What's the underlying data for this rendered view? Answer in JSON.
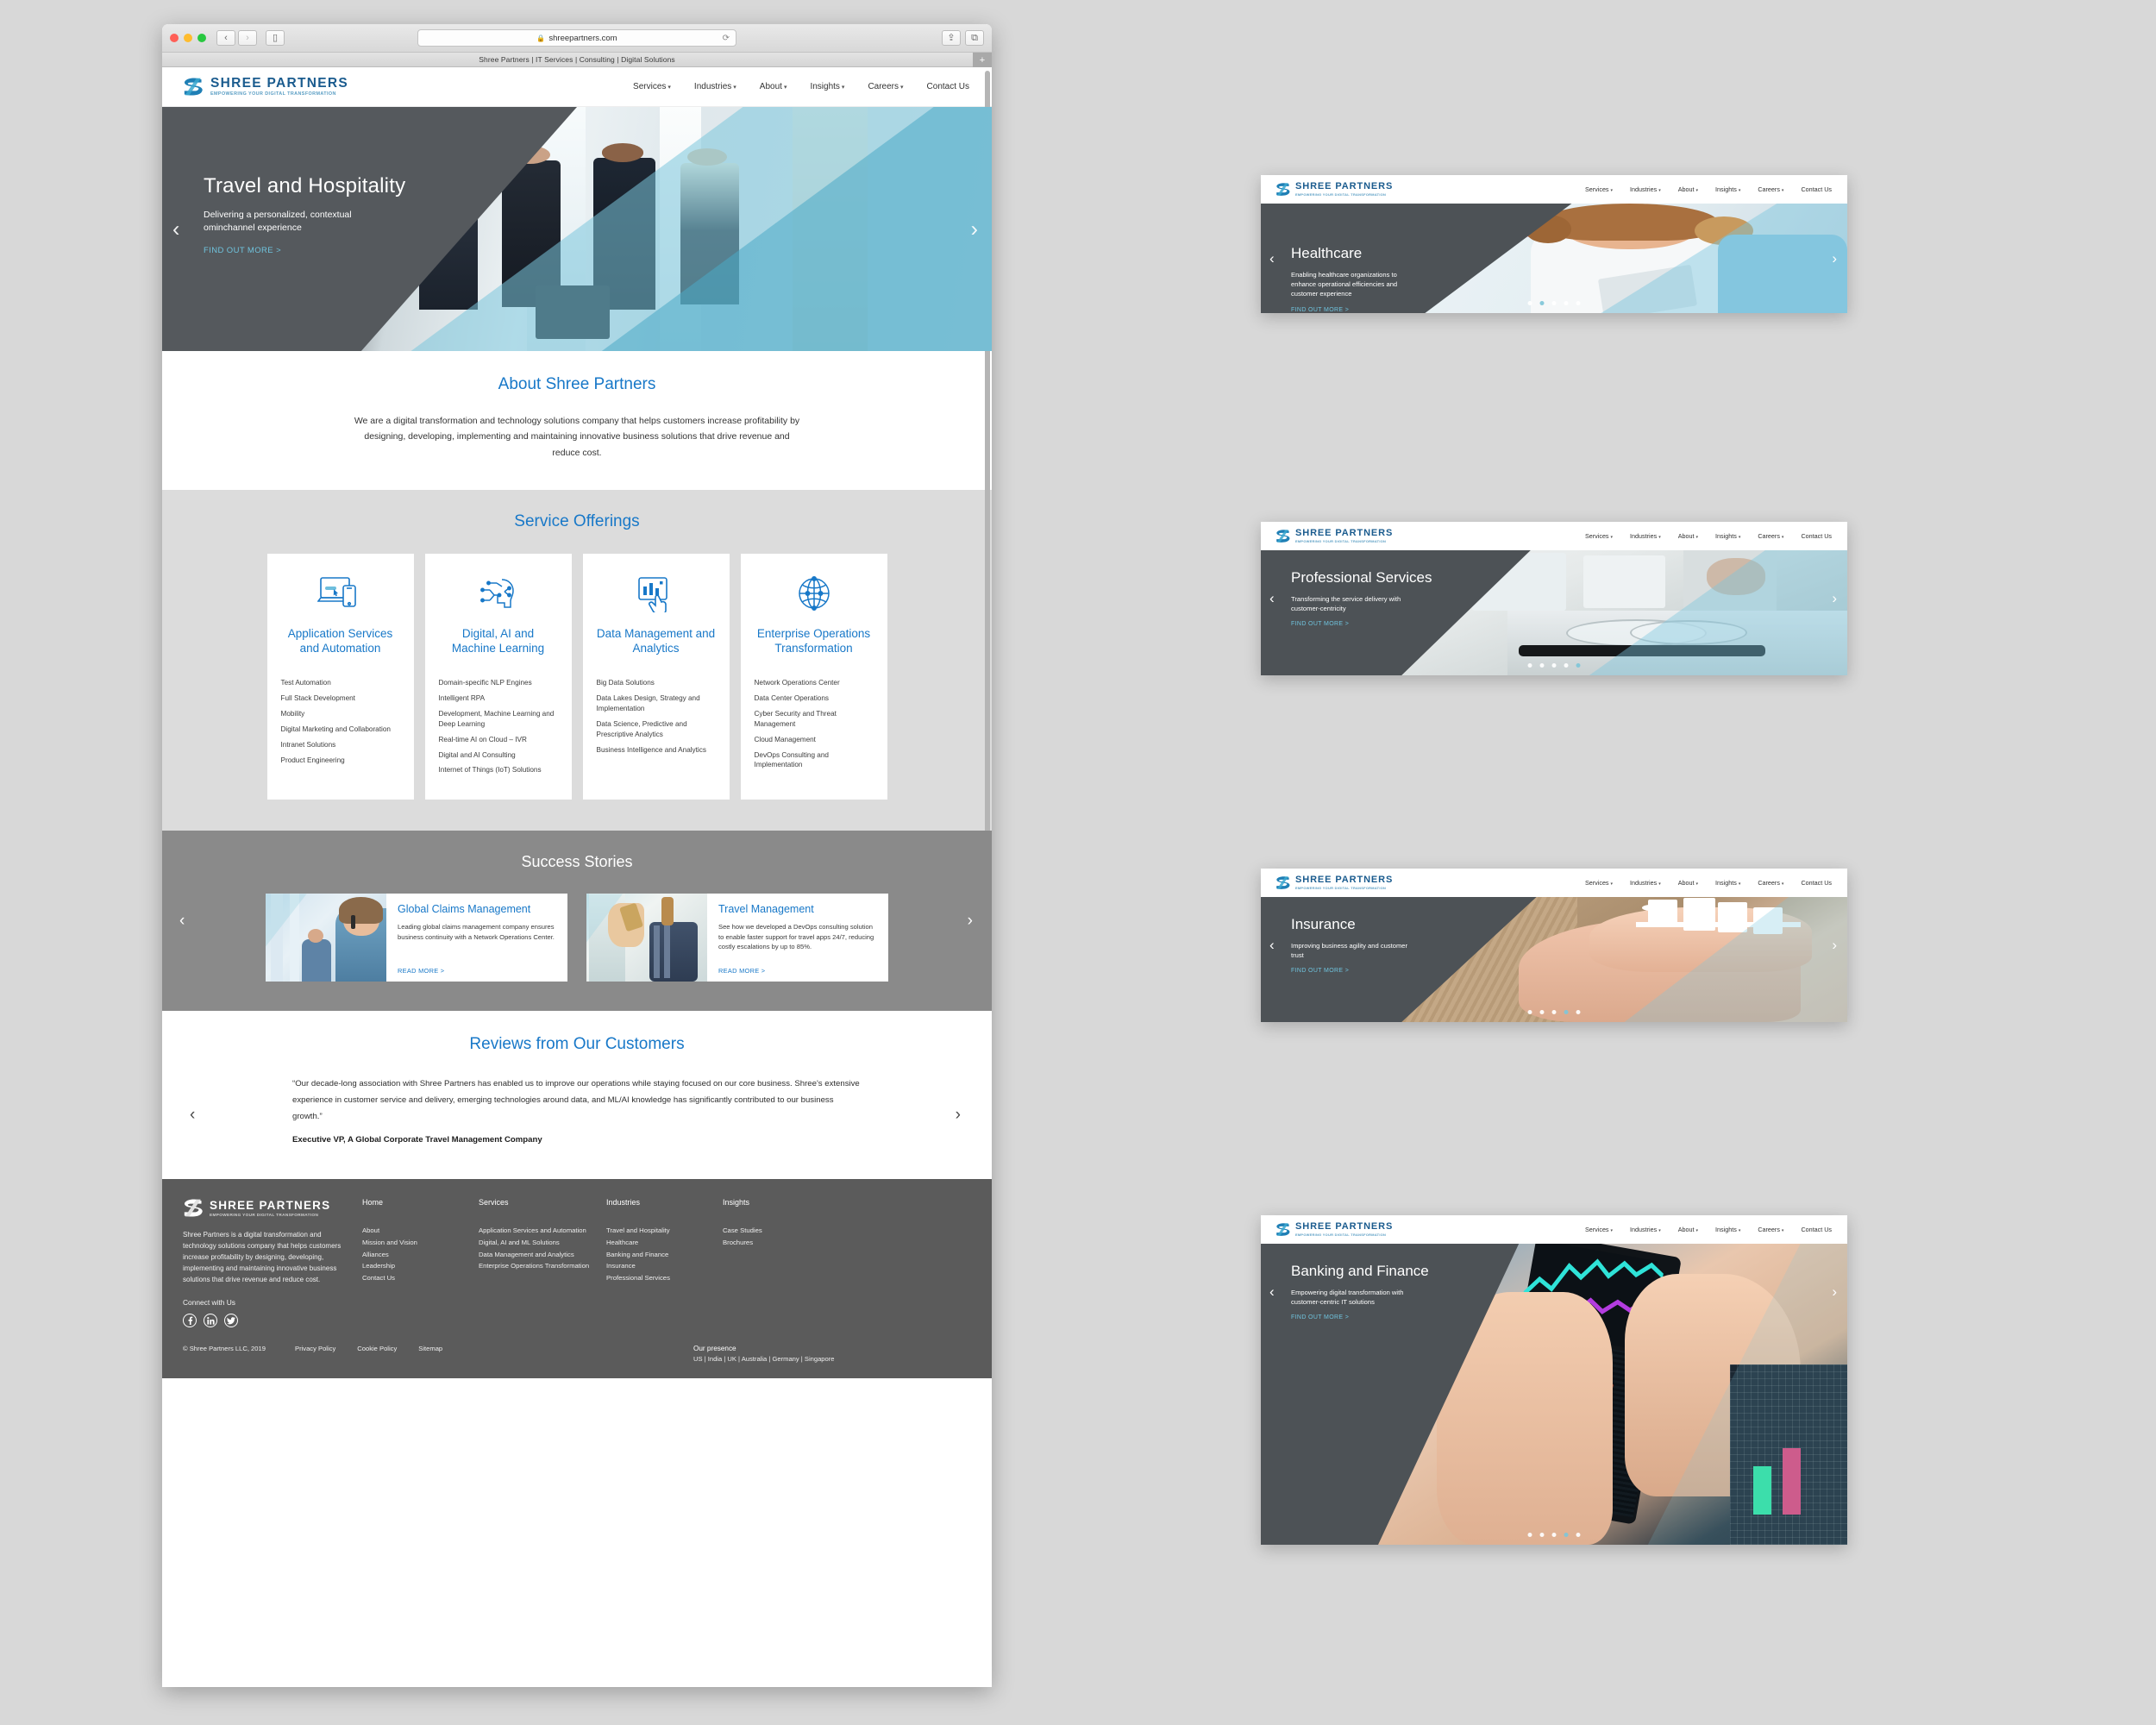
{
  "browser": {
    "url": "shreepartners.com",
    "lock_icon": "lock-icon",
    "reload_icon": "reload-icon",
    "tab_title": "Shree Partners | IT Services | Consulting | Digital Solutions",
    "back_icon": "back-icon",
    "forward_icon": "forward-icon",
    "sidebar_icon": "sidebar-icon",
    "share_icon": "share-icon",
    "tabs_icon": "tabs-overview-icon",
    "new_tab_icon": "new-tab-icon"
  },
  "brand": {
    "name": "SHREE PARTNERS",
    "tagline": "EMPOWERING YOUR DIGITAL TRANSFORMATION",
    "logo_icon": "shree-partners-logo-icon",
    "accent_blue": "#1878c8",
    "logo_blue": "#1a5b8e",
    "cta_teal": "#6fc3dd"
  },
  "nav": {
    "items": [
      {
        "label": "Services",
        "has_caret": true
      },
      {
        "label": "Industries",
        "has_caret": true
      },
      {
        "label": "About",
        "has_caret": true
      },
      {
        "label": "Insights",
        "has_caret": true
      },
      {
        "label": "Careers",
        "has_caret": true
      },
      {
        "label": "Contact Us",
        "has_caret": false
      }
    ]
  },
  "hero": {
    "title": "Travel and Hospitality",
    "subtitle": "Delivering a personalized, contextual ominchannel experience",
    "cta": "FIND OUT MORE >",
    "prev_icon": "chevron-left-icon",
    "next_icon": "chevron-right-icon"
  },
  "about": {
    "heading": "About Shree Partners",
    "body": "We are a digital transformation and technology solutions company that helps customers increase profitability by designing, developing, implementing and maintaining innovative business solutions that drive revenue and reduce cost."
  },
  "services": {
    "heading": "Service Offerings",
    "cards": [
      {
        "icon": "laptop-mobile-icon",
        "title": "Application Services and Automation",
        "items": [
          "Test Automation",
          "Full Stack Development",
          "Mobility",
          "Digital Marketing and Collaboration",
          "Intranet Solutions",
          "Product Engineering"
        ]
      },
      {
        "icon": "ai-brain-head-icon",
        "title": "Digital, AI and Machine Learning",
        "items": [
          "Domain-specific NLP Engines",
          "Intelligent RPA",
          "Development, Machine Learning and Deep Learning",
          "Real-time AI on Cloud – IVR",
          "Digital and AI Consulting",
          "Internet of Things (IoT) Solutions"
        ]
      },
      {
        "icon": "bar-chart-tablet-icon",
        "title": "Data Management and Analytics",
        "items": [
          "Big Data Solutions",
          "Data Lakes Design, Strategy and Implementation",
          "Data Science, Predictive and Prescriptive Analytics",
          "Business Intelligence and Analytics"
        ]
      },
      {
        "icon": "globe-network-icon",
        "title": "Enterprise Operations Transformation",
        "items": [
          "Network Operations Center",
          "Data Center Operations",
          "Cyber Security and Threat Management",
          "Cloud Management",
          "DevOps Consulting and Implementation"
        ]
      }
    ]
  },
  "success": {
    "heading": "Success Stories",
    "prev_icon": "chevron-left-icon",
    "next_icon": "chevron-right-icon",
    "stories": [
      {
        "title": "Global Claims Management",
        "text": "Leading global claims management company ensures business continuity with a Network Operations Center.",
        "cta": "READ MORE >",
        "image": "call-center-agent-photo"
      },
      {
        "title": "Travel Management",
        "text": "See how we developed a DevOps consulting solution to enable faster support for travel apps 24/7, reducing costly escalations by up to 85%.",
        "cta": "READ MORE >",
        "image": "hand-phone-luggage-photo"
      }
    ]
  },
  "reviews": {
    "heading": "Reviews from Our Customers",
    "quote": "“Our decade-long association with Shree Partners has enabled us to improve our operations while staying focused on our core business. Shree's extensive experience in customer service and delivery, emerging technologies around data, and ML/AI knowledge has significantly contributed to our business growth.”",
    "attribution": "Executive VP, A Global Corporate Travel Management Company",
    "prev_icon": "chevron-left-icon",
    "next_icon": "chevron-right-icon"
  },
  "footer": {
    "description": "Shree Partners is a digital transformation and technology solutions company that helps customers increase profitability by designing, developing, implementing and maintaining innovative business solutions that drive revenue and reduce cost.",
    "connect_label": "Connect with Us",
    "socials": [
      {
        "icon": "facebook-icon",
        "glyph": "f"
      },
      {
        "icon": "linkedin-icon",
        "glyph": "in"
      },
      {
        "icon": "twitter-icon",
        "glyph": "🐦"
      }
    ],
    "columns": [
      {
        "head": "Home",
        "items": [
          "About",
          "Mission and Vision",
          "Alliances",
          "Leadership",
          "Contact Us"
        ]
      },
      {
        "head": "Services",
        "items": [
          "Application Services and Automation",
          "Digital, AI and ML Solutions",
          "Data Management and Analytics",
          "Enterprise Operations Transformation"
        ]
      },
      {
        "head": "Industries",
        "items": [
          "Travel and Hospitality",
          "Healthcare",
          "Banking and Finance",
          "Insurance",
          "Professional Services"
        ]
      },
      {
        "head": "Insights",
        "items": [
          "Case Studies",
          "Brochures"
        ]
      }
    ],
    "copyright": "© Shree Partners LLC, 2019",
    "legal": [
      "Privacy Policy",
      "Cookie Policy",
      "Sitemap"
    ],
    "presence_label": "Our presence",
    "presence_list": "US | India | UK | Australia | Germany | Singapore"
  },
  "panels": [
    {
      "title": "Healthcare",
      "subtitle": "Enabling healthcare organizations to enhance operational efficiencies and customer experience",
      "cta": "FIND OUT MORE >",
      "image": "doctor-with-tablet-photo",
      "dots_total": 5,
      "dot_active": 2
    },
    {
      "title": "Professional Services",
      "subtitle": "Transforming the service delivery with customer-centricity",
      "cta": "FIND OUT MORE >",
      "image": "glasses-pen-desk-photo",
      "dots_total": 5,
      "dot_active": 5
    },
    {
      "title": "Insurance",
      "subtitle": "Improving business agility and customer trust",
      "cta": "FIND OUT MORE >",
      "image": "hands-paper-family-photo",
      "dots_total": 5,
      "dot_active": 4
    },
    {
      "title": "Banking and Finance",
      "subtitle": "Empowering digital transformation with customer-centric IT solutions",
      "cta": "FIND OUT MORE >",
      "image": "smartphone-stock-chart-photo",
      "dots_total": 5,
      "dot_active": 4
    }
  ]
}
